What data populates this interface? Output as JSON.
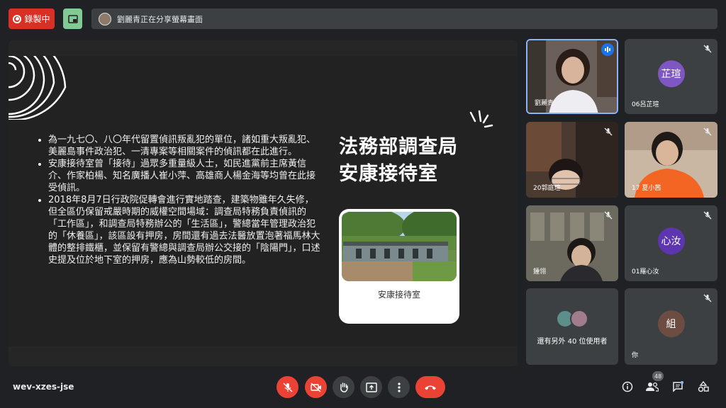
{
  "topbar": {
    "record_label": "錄製中",
    "share_text": "劉麗青正在分享螢幕畫面"
  },
  "slide": {
    "title_line1": "法務部調查局",
    "title_line2": "安康接待室",
    "bullets": [
      "為一九七〇、八〇年代留置偵訊叛亂犯的單位，諸如重大叛亂犯、美麗島事件政治犯、一清專案等相關案件的偵訊都在此進行。",
      "安康接待室曾「接待」過眾多重量級人士，如民進黨前主席黃信介、作家柏楊、知名廣播人崔小萍、高雄商人楊金海等均曾在此接受偵訊。",
      "2018年8月7日行政院促轉會進行實地踏查，建築物雖年久失修，但全區仍保留戒嚴時期的威權空間場域：調查局特務負責偵訊的「工作區」，和調查局特務辦公的「生活區」，警總當年管理政治犯的「休養區」，該區設有押房，房間還有過去法醫放置泡著福馬林大體的整排鐵櫃，並保留有警總與調查局辦公交接的「陰陽門」，口述史提及位於地下室的押房，應為山勢較低的房間。"
    ],
    "photo_caption": "安康接待室"
  },
  "participants": [
    {
      "name": "劉麗青",
      "type": "video",
      "speaking": true
    },
    {
      "name": "06呂芷瑄",
      "initials": "芷瑄",
      "color": "#7e57c2",
      "muted": true
    },
    {
      "name": "20郭庭瑄",
      "type": "video",
      "muted": true
    },
    {
      "name": "17 夏小茜",
      "type": "video",
      "muted": true
    },
    {
      "name": "鍾翎",
      "type": "video",
      "muted": true
    },
    {
      "name": "01羅心汝",
      "initials": "心汝",
      "color": "#5e35b1",
      "muted": true
    },
    {
      "name": "還有另外 40 位使用者",
      "type": "others"
    },
    {
      "name": "你",
      "initials": "組",
      "color": "#6d4c41",
      "muted": true
    }
  ],
  "bottombar": {
    "meeting_code": "wev-xzes-jse",
    "people_count": "48"
  },
  "colors": {
    "accent_red": "#ea4335",
    "rec_red": "#d93025",
    "pip_green": "#81c995"
  }
}
